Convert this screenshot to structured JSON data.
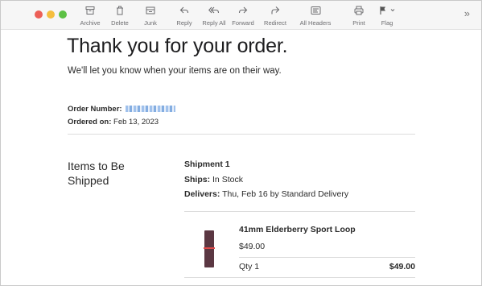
{
  "toolbar": {
    "buttons": [
      {
        "label": "Archive",
        "icon": "archive-icon"
      },
      {
        "label": "Delete",
        "icon": "trash-icon"
      },
      {
        "label": "Junk",
        "icon": "junk-icon"
      },
      {
        "label": "Reply",
        "icon": "reply-icon"
      },
      {
        "label": "Reply All",
        "icon": "reply-all-icon"
      },
      {
        "label": "Forward",
        "icon": "forward-icon"
      },
      {
        "label": "Redirect",
        "icon": "redirect-icon"
      },
      {
        "label": "All Headers",
        "icon": "all-headers-icon"
      },
      {
        "label": "Print",
        "icon": "printer-icon"
      },
      {
        "label": "Flag",
        "icon": "flag-icon"
      }
    ],
    "overflow": "»"
  },
  "email": {
    "title": "Thank you for your order.",
    "subtitle": "We'll let you know when your items are on their way.",
    "order_number_label": "Order Number:",
    "ordered_on_label": "Ordered on:",
    "ordered_on_value": "Feb 13, 2023",
    "items_heading": "Items to Be Shipped",
    "shipment": {
      "title": "Shipment 1",
      "ships_label": "Ships:",
      "ships_value": "In Stock",
      "delivers_label": "Delivers:",
      "delivers_value": "Thu, Feb 16 by Standard Delivery"
    },
    "item": {
      "name": "41mm Elderberry Sport Loop",
      "price": "$49.00",
      "qty": "Qty 1",
      "total": "$49.00"
    }
  },
  "colors": {
    "traffic_red": "#ec5f57",
    "traffic_yellow": "#f5be3e",
    "traffic_green": "#5dc145",
    "band_color": "#5b3742"
  }
}
